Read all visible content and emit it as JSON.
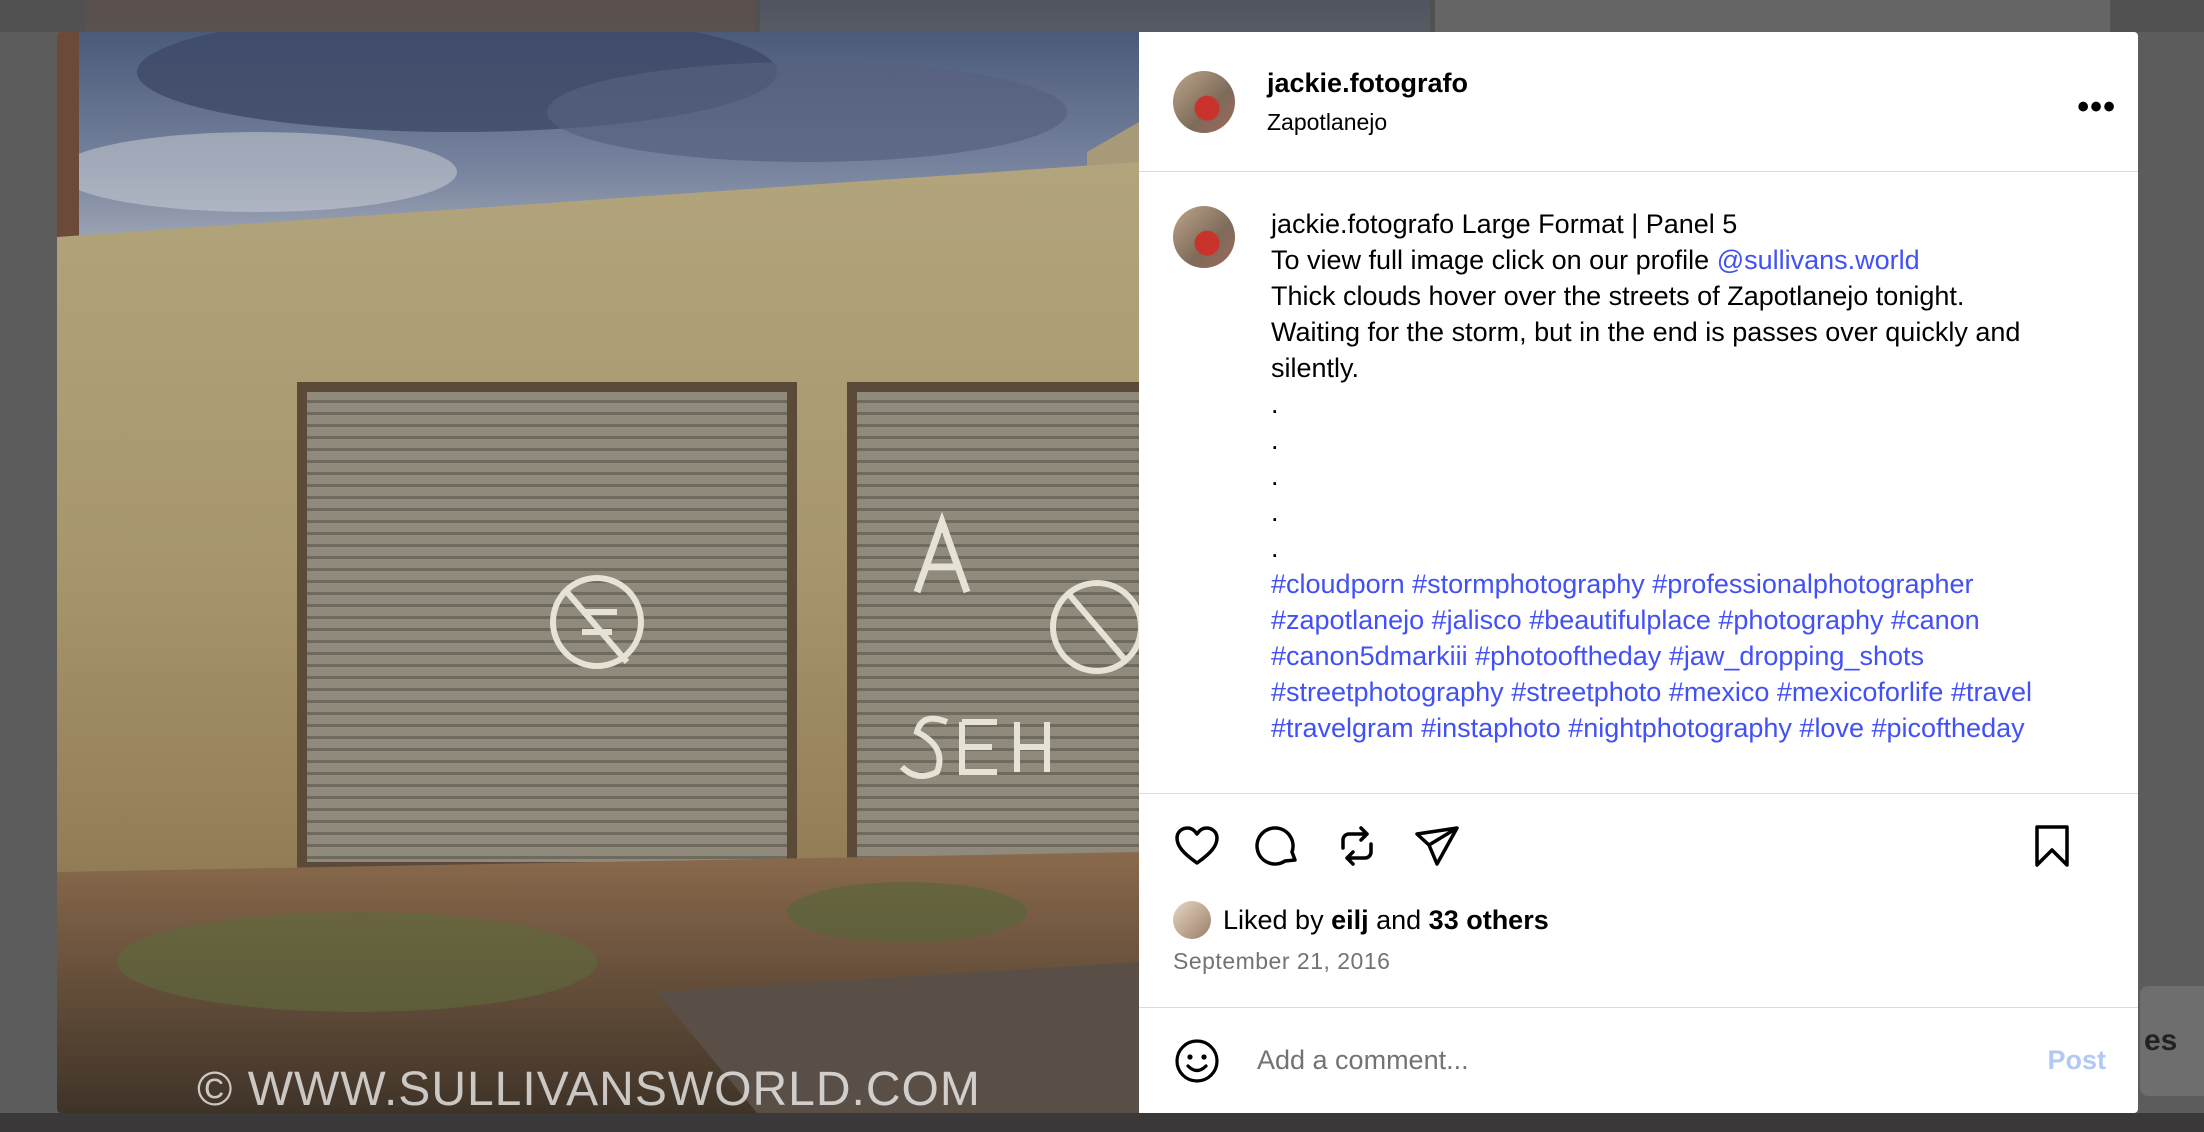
{
  "post": {
    "username": "jackie.fotografo",
    "location": "Zapotlanejo",
    "more_label": "•••",
    "photo": {
      "watermark": "© WWW.SULLIVANSWORLD.COM"
    },
    "caption": {
      "username": "jackie.fotografo",
      "title": "Large Format | Panel 5",
      "line1": "To view full image click on our profile ",
      "mention": "@sullivans.world",
      "body": "Thick clouds hover over the streets of Zapotlanejo tonight. Waiting for the storm, but in the end is passes over quickly and silently.",
      "dots": [
        ".",
        ".",
        ".",
        ".",
        "."
      ],
      "hashtags": [
        "#cloudporn",
        "#stormphotography",
        "#professionalphotographer",
        "#zapotlanejo",
        "#jalisco",
        "#beautifulplace",
        "#photography",
        "#canon",
        "#canon5dmarkiii",
        "#photooftheday",
        "#jaw_dropping_shots",
        "#streetphotography",
        "#streetphoto",
        "#mexico",
        "#mexicoforlife",
        "#travel",
        "#travelgram",
        "#instaphoto",
        "#nightphotography",
        "#love",
        "#picoftheday"
      ]
    },
    "likes": {
      "prefix": "Liked by ",
      "user": "eilj",
      "middle": " and ",
      "others": "33 others"
    },
    "date": "September 21, 2016",
    "comment": {
      "placeholder": "Add a comment...",
      "post_label": "Post"
    },
    "icons": [
      "heart-icon",
      "comment-icon",
      "repost-icon",
      "share-icon",
      "bookmark-icon",
      "emoji-icon"
    ]
  },
  "background": {
    "side_text": "es"
  },
  "colors": {
    "link": "#4150f7",
    "muted": "#737373",
    "post_button": "#b2c8f6",
    "border": "#dbdbdb"
  }
}
